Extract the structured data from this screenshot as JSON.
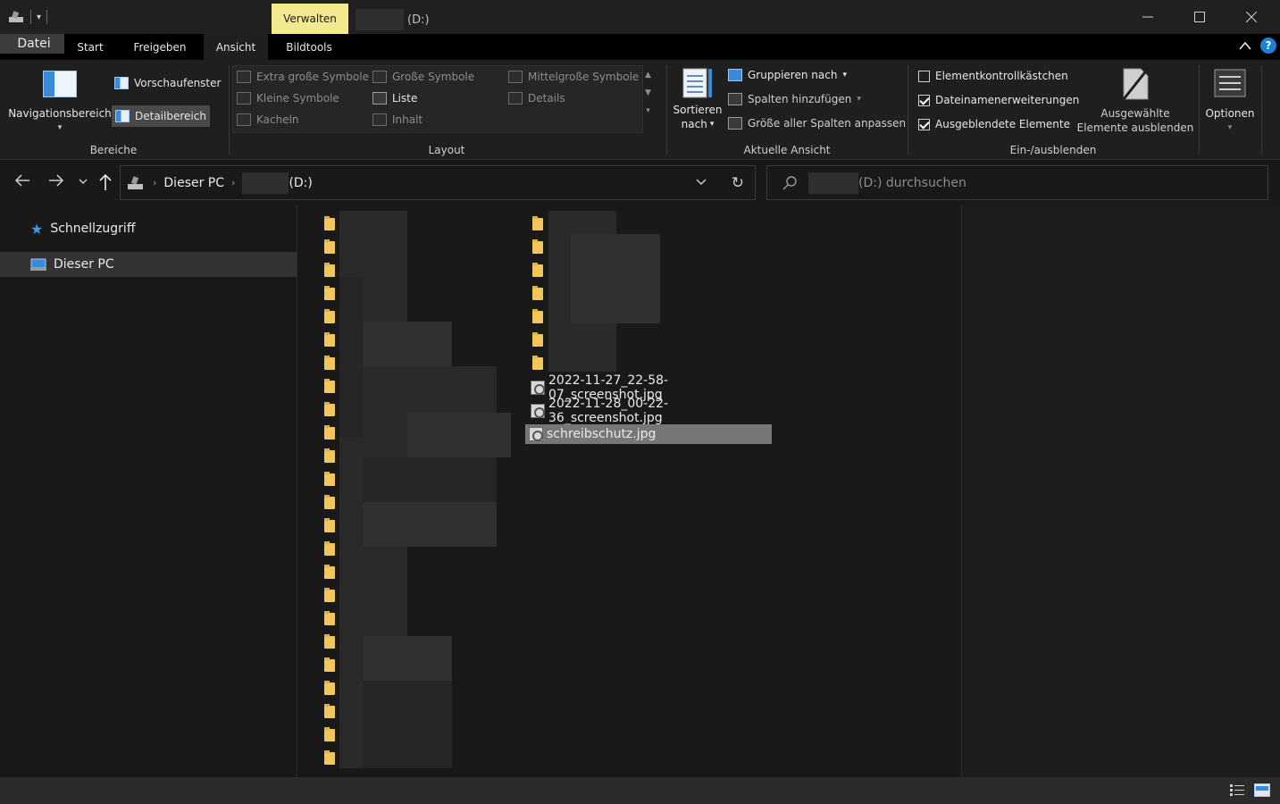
{
  "window": {
    "context_tab": "Verwalten",
    "title": "(D:)"
  },
  "ribbon_tabs": [
    "Datei",
    "Start",
    "Freigeben",
    "Ansicht",
    "Bildtools"
  ],
  "ribbon": {
    "bereiche": {
      "label": "Bereiche",
      "navigationsbereich": "Navigationsbereich",
      "vorschaufenster": "Vorschaufenster",
      "detailbereich": "Detailbereich"
    },
    "layout": {
      "label": "Layout",
      "items": [
        "Extra große Symbole",
        "Große Symbole",
        "Mittelgroße Symbole",
        "Kleine Symbole",
        "Liste",
        "Details",
        "Kacheln",
        "Inhalt"
      ]
    },
    "aktuelle_ansicht": {
      "label": "Aktuelle Ansicht",
      "sortieren_line1": "Sortieren",
      "sortieren_line2": "nach",
      "gruppieren": "Gruppieren nach",
      "spalten": "Spalten hinzufügen",
      "groesse": "Größe aller Spalten anpassen"
    },
    "ein_ausblenden": {
      "label": "Ein-/ausblenden",
      "checkboxes": [
        {
          "label": "Elementkontrollkästchen",
          "checked": false
        },
        {
          "label": "Dateinamenerweiterungen",
          "checked": true
        },
        {
          "label": "Ausgeblendete Elemente",
          "checked": true
        }
      ],
      "ausgewaehlte_line1": "Ausgewählte",
      "ausgewaehlte_line2": "Elemente ausblenden"
    },
    "optionen": "Optionen"
  },
  "address": {
    "crumb1": "Dieser PC",
    "crumb2": "(D:)"
  },
  "search": {
    "placeholder": "(D:) durchsuchen"
  },
  "nav": {
    "schnellzugriff": "Schnellzugriff",
    "dieser_pc": "Dieser PC"
  },
  "files": [
    {
      "name": "2022-11-27_22-58-07_screenshot.jpg",
      "selected": false
    },
    {
      "name": "2022-11-28_00-22-36_screenshot.jpg",
      "selected": false
    },
    {
      "name": "schreibschutz.jpg",
      "selected": true
    }
  ],
  "colors": {
    "context_tab": "#f3ea8f",
    "folder": "#f1c75b",
    "accent": "#1e7fd6"
  }
}
